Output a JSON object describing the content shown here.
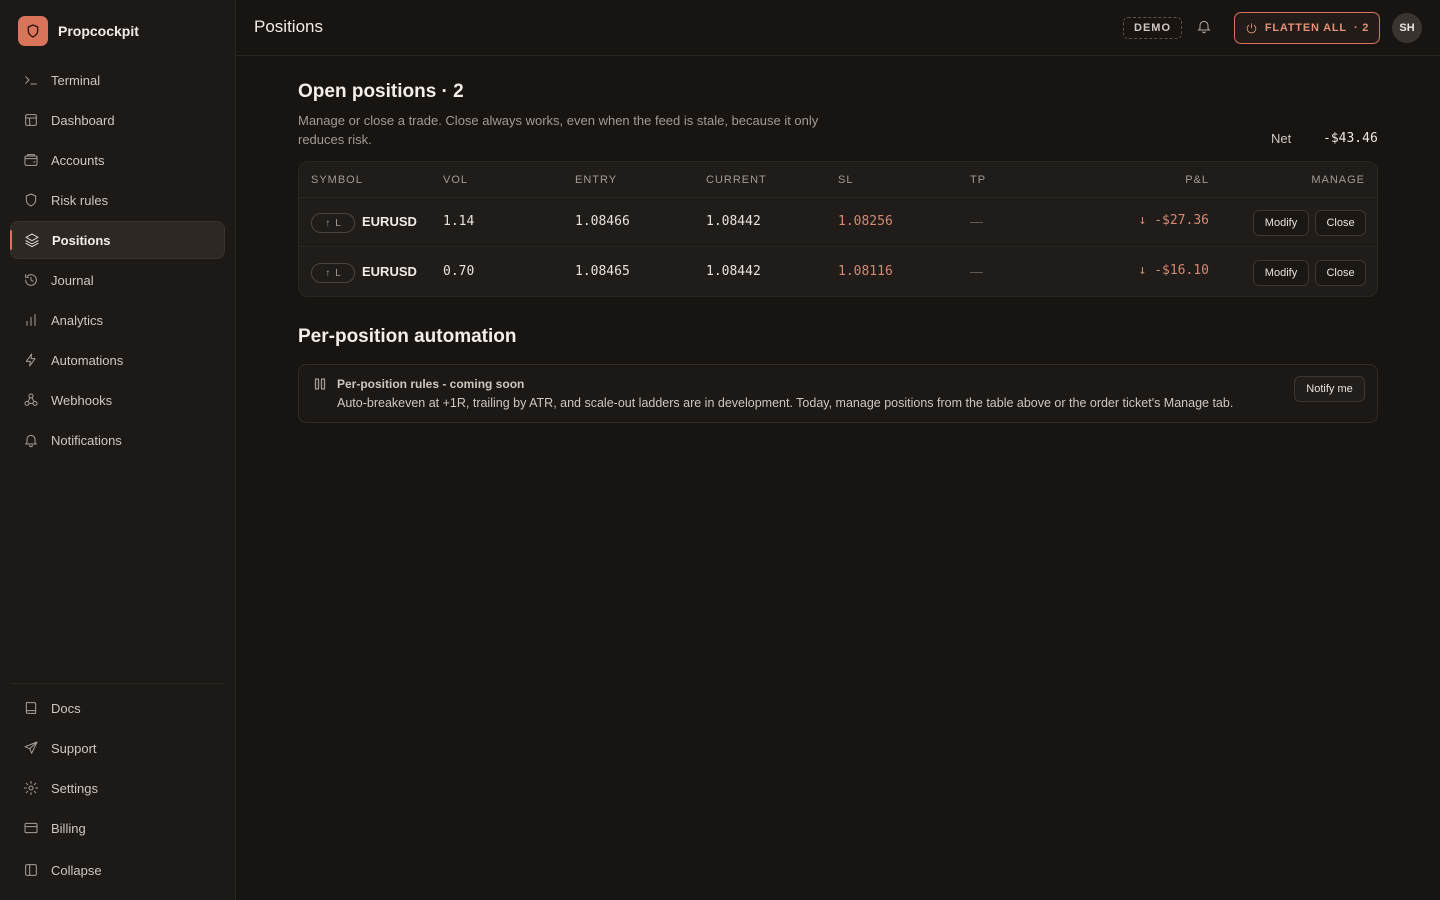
{
  "app": {
    "name": "Propcockpit"
  },
  "sidebar": {
    "items": [
      {
        "label": "Terminal",
        "icon": "terminal-icon"
      },
      {
        "label": "Dashboard",
        "icon": "dashboard-icon"
      },
      {
        "label": "Accounts",
        "icon": "wallet-icon"
      },
      {
        "label": "Risk rules",
        "icon": "shield-icon"
      },
      {
        "label": "Positions",
        "icon": "layers-icon",
        "active": true
      },
      {
        "label": "Journal",
        "icon": "history-icon"
      },
      {
        "label": "Analytics",
        "icon": "bar-chart-icon"
      },
      {
        "label": "Automations",
        "icon": "zap-icon"
      },
      {
        "label": "Webhooks",
        "icon": "webhook-icon"
      },
      {
        "label": "Notifications",
        "icon": "bell-icon"
      }
    ],
    "bottom_items": [
      {
        "label": "Docs",
        "icon": "book-icon"
      },
      {
        "label": "Support",
        "icon": "send-icon"
      },
      {
        "label": "Settings",
        "icon": "gear-icon"
      },
      {
        "label": "Billing",
        "icon": "credit-card-icon"
      },
      {
        "label": "Collapse",
        "icon": "sidebar-collapse-icon"
      }
    ]
  },
  "topbar": {
    "title": "Positions",
    "demo_badge": "DEMO",
    "flatten_label": "FLATTEN ALL",
    "flatten_count": "· 2",
    "avatar_initials": "SH"
  },
  "open_positions": {
    "title": "Open positions · 2",
    "subtitle": "Manage or close a trade. Close always works, even when the feed is stale, because it only reduces risk.",
    "net_label": "Net",
    "net_value": "-$43.46",
    "columns": [
      "SYMBOL",
      "VOL",
      "ENTRY",
      "CURRENT",
      "SL",
      "TP",
      "P&L",
      "MANAGE"
    ],
    "rows": [
      {
        "side_arrow": "↑",
        "side": "L",
        "symbol": "EURUSD",
        "vol": "1.14",
        "entry": "1.08466",
        "current": "1.08442",
        "sl": "1.08256",
        "tp": "—",
        "pnl": "↓ -$27.36",
        "modify": "Modify",
        "close": "Close"
      },
      {
        "side_arrow": "↑",
        "side": "L",
        "symbol": "EURUSD",
        "vol": "0.70",
        "entry": "1.08465",
        "current": "1.08442",
        "sl": "1.08116",
        "tp": "—",
        "pnl": "↓ -$16.10",
        "modify": "Modify",
        "close": "Close"
      }
    ]
  },
  "automation": {
    "title": "Per-position automation",
    "card_title": "Per-position rules - coming soon",
    "card_desc": "Auto-breakeven at +1R, trailing by ATR, and scale-out ladders are in development. Today, manage positions from the table above or the order ticket's Manage tab.",
    "notify_label": "Notify me"
  },
  "colors": {
    "accent": "#d9735a",
    "loss": "#d48a72",
    "background": "#171411",
    "sidebar": "#1c1916"
  }
}
